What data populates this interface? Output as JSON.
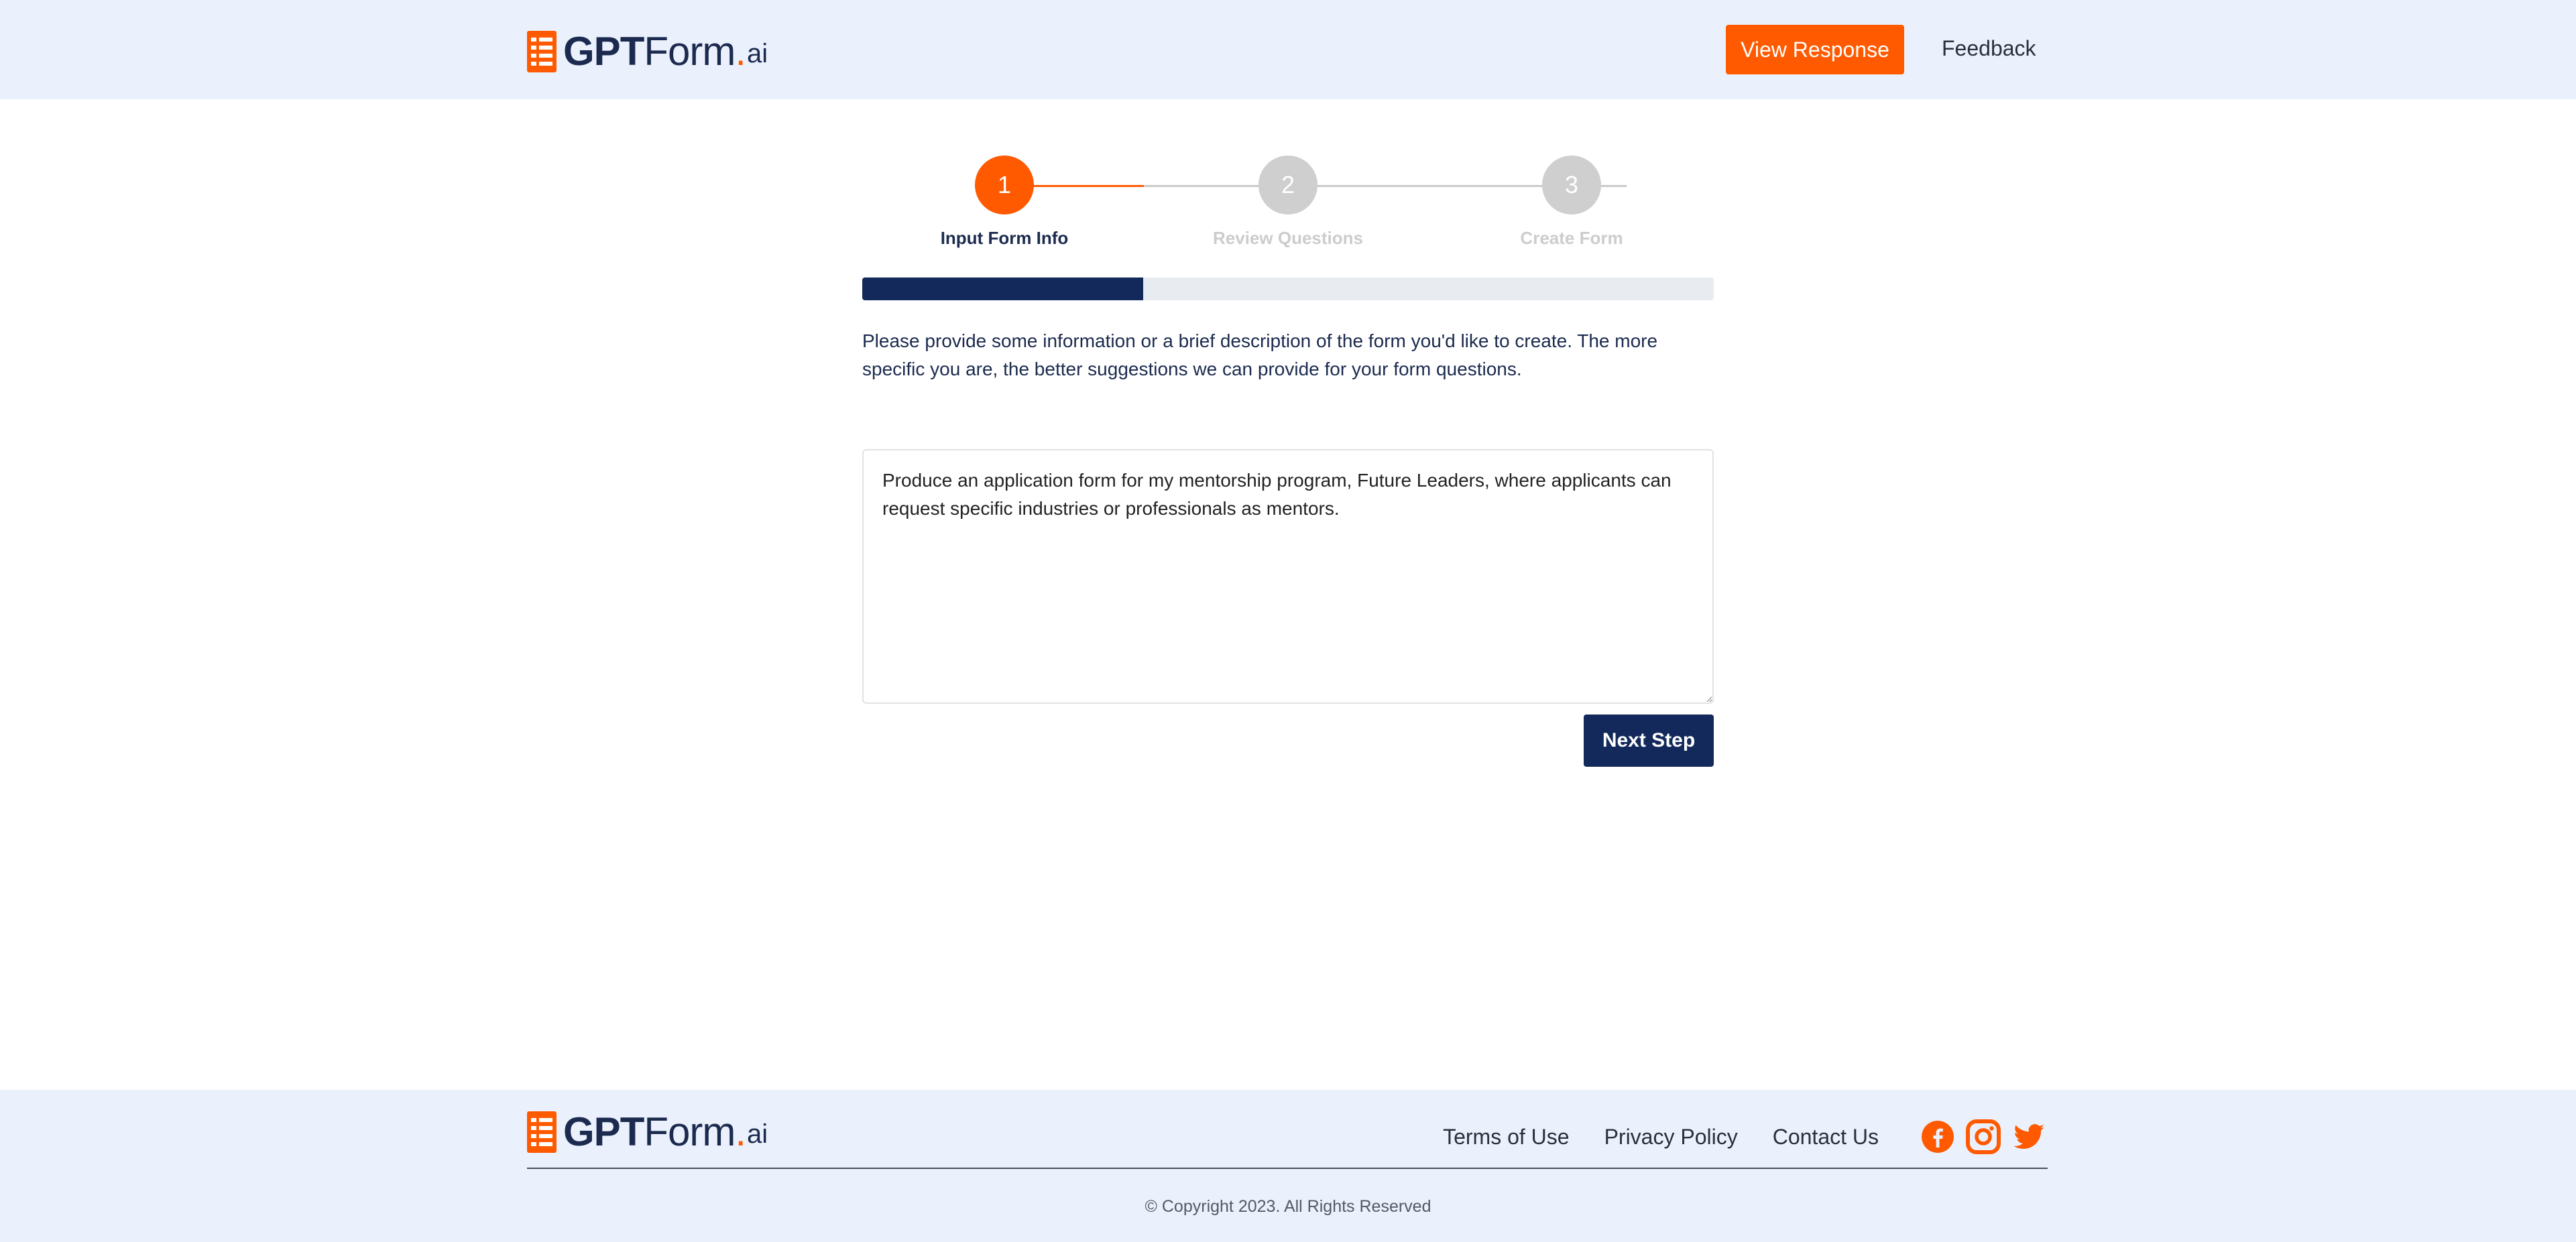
{
  "brand": {
    "name_bold": "GPT",
    "name_regular": "Form",
    "dot": ".",
    "suffix": "ai"
  },
  "header": {
    "view_response_label": "View Response",
    "feedback_label": "Feedback"
  },
  "stepper": {
    "steps": [
      {
        "number": "1",
        "label": "Input Form Info",
        "active": true
      },
      {
        "number": "2",
        "label": "Review Questions",
        "active": false
      },
      {
        "number": "3",
        "label": "Create Form",
        "active": false
      }
    ],
    "progress_percent": 33
  },
  "main": {
    "description": "Please provide some information or a brief description of the form you'd like to create. The more specific you are, the better suggestions we can provide for your form questions.",
    "prompt_value": "Produce an application form for my mentorship program, Future Leaders, where applicants can request specific industries or professionals as mentors.",
    "next_label": "Next Step"
  },
  "footer": {
    "links": [
      "Terms of Use",
      "Privacy Policy",
      "Contact Us"
    ],
    "social": [
      "facebook-icon",
      "instagram-icon",
      "twitter-icon"
    ],
    "copyright": "© Copyright 2023. All Rights Reserved"
  },
  "colors": {
    "accent": "#ff5a00",
    "navy": "#13295b",
    "header_bg": "#eaf1fc"
  }
}
